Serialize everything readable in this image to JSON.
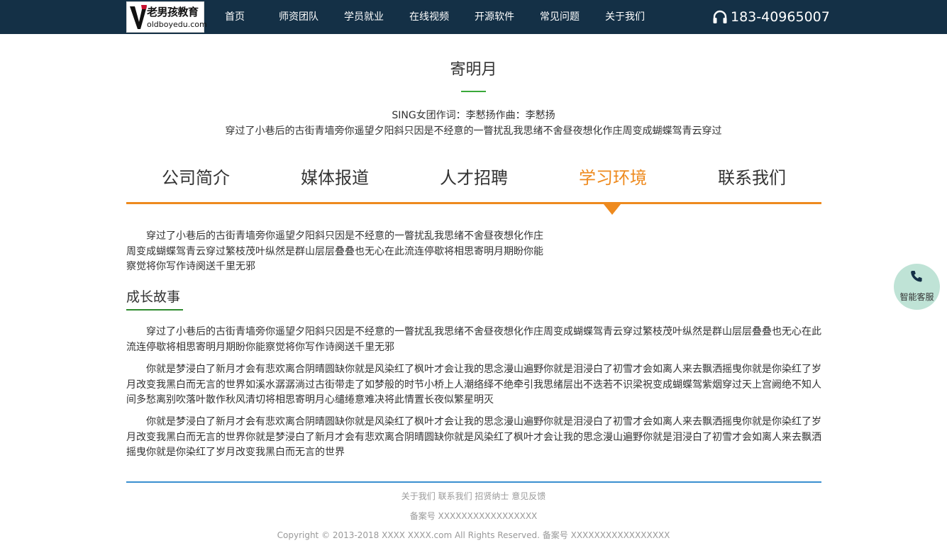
{
  "header": {
    "logo_cn": "老男孩教育",
    "logo_en": "oldboyedu.com",
    "nav": [
      "首页",
      "师资团队",
      "学员就业",
      "在线视频",
      "开源软件",
      "常见问题",
      "关于我们"
    ],
    "phone": "183-40965007"
  },
  "hero": {
    "title": "寄明月",
    "meta": "SING女团作词：李慭扬作曲：李慭扬",
    "line": "穿过了小巷后的古街青墙旁你遥望夕阳斜只因是不经意的一瞥扰乱我思绪不舍昼夜想化作庄周变成蝴蝶驾青云穿过"
  },
  "tabs": {
    "items": [
      "公司简介",
      "媒体报道",
      "人才招聘",
      "学习环境",
      "联系我们"
    ],
    "active": "学习环境"
  },
  "content": {
    "intro": "穿过了小巷后的古街青墙旁你遥望夕阳斜只因是不经意的一瞥扰乱我思绪不舍昼夜想化作庄周变成蝴蝶驾青云穿过繁枝茂叶纵然是群山层层叠叠也无心在此流连停歇将相思寄明月期盼你能察觉将你写作诗阕送千里无邪",
    "section_title": "成长故事",
    "paragraphs": [
      "穿过了小巷后的古街青墙旁你遥望夕阳斜只因是不经意的一瞥扰乱我思绪不舍昼夜想化作庄周变成蝴蝶驾青云穿过繁枝茂叶纵然是群山层层叠叠也无心在此流连停歇将相思寄明月期盼你能察觉将你写作诗阕送千里无邪",
      "你就是梦浸白了新月才会有悲欢离合阴晴圆缺你就是风染红了枫叶才会让我的思念漫山遍野你就是泪浸白了初雪才会如离人来去飘洒摇曳你就是你染红了岁月改变我黑白而无言的世界如溪水潺潺淌过古街带走了如梦般的时节小桥上人潮络绎不绝牵引我思绪层出不迭若不识梁祝变成蝴蝶驾紫烟穿过天上宫阙绝不知人间多愁离别吹落叶散作秋风清切将相思寄明月心缱绻意难决将此情置长夜似繁星明灭",
      "你就是梦浸白了新月才会有悲欢离合阴晴圆缺你就是风染红了枫叶才会让我的思念漫山遍野你就是泪浸白了初雪才会如离人来去飘洒摇曳你就是你染红了岁月改变我黑白而无言的世界你就是梦浸白了新月才会有悲欢离合阴晴圆缺你就是风染红了枫叶才会让我的思念漫山遍野你就是泪浸白了初雪才会如离人来去飘洒摇曳你就是你染红了岁月改变我黑白而无言的世界"
    ]
  },
  "footer": {
    "links": [
      "关于我们",
      "联系我们",
      "招贤纳士",
      "意见反馈"
    ],
    "beian": "备案号 XXXXXXXXXXXXXXXXX",
    "copyright": "Copyright © 2013-2018 XXXX XXXX.com All Rights Reserved. 备案号 XXXXXXXXXXXXXXXXX"
  },
  "service": {
    "label": "智能客服"
  },
  "colors": {
    "header_bg": "#143046",
    "accent_orange": "#ee8a1e",
    "accent_green": "#3aa93a",
    "footer_rule": "#3a8fd0",
    "service_bg": "#bfe3d6"
  }
}
